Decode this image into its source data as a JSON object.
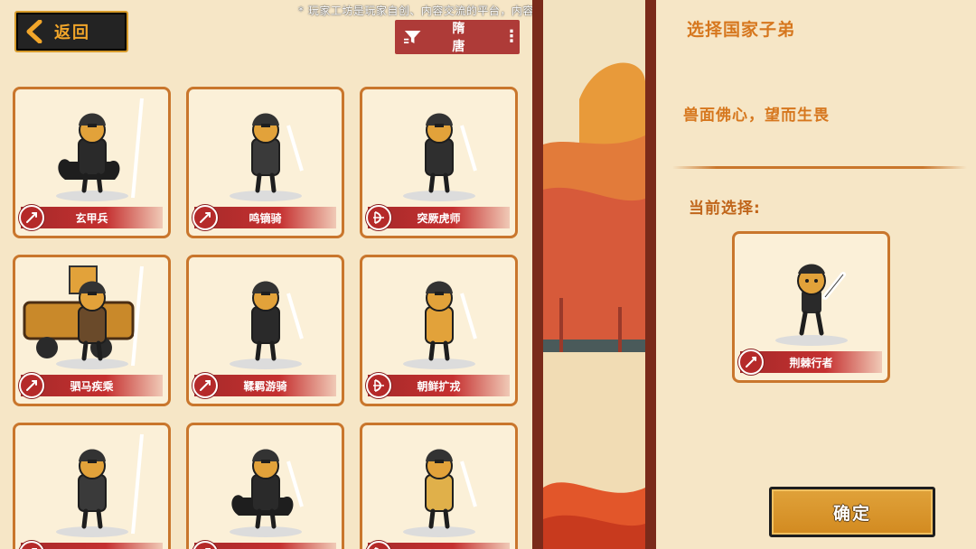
{
  "disclaimer": "* 玩家工坊是玩家自创、内容交流的平台，内容不代表制作组立场",
  "back_button": {
    "label": "返回"
  },
  "filter": {
    "label": "隋唐",
    "more": "⋮"
  },
  "units": [
    {
      "name": "玄甲兵",
      "icon": "spear-emblem-icon"
    },
    {
      "name": "鸣镝骑",
      "icon": "spear-emblem-icon"
    },
    {
      "name": "突厥虎师",
      "icon": "bow-emblem-icon"
    },
    {
      "name": "驷马疾乘",
      "icon": "spear-emblem-icon"
    },
    {
      "name": "鞣羁游骑",
      "icon": "spear-emblem-icon"
    },
    {
      "name": "朝鲜扩戎",
      "icon": "bow-emblem-icon"
    },
    {
      "name": "",
      "icon": "spear-emblem-icon"
    },
    {
      "name": "",
      "icon": "spear-emblem-icon"
    },
    {
      "name": "",
      "icon": "bow-emblem-icon"
    }
  ],
  "panel": {
    "title": "选择国家子弟",
    "motto": "兽面佛心，望而生畏",
    "current_label": "当前选择:",
    "selected_unit": {
      "name": "荆棘行者",
      "icon": "sword-emblem-icon"
    },
    "confirm_label": "确定"
  },
  "colors": {
    "background": "#f6e6c6",
    "accent_orange": "#d6771e",
    "card_border": "#c9762c",
    "banner_red": "#c53030",
    "divider": "#7a2a1a"
  }
}
